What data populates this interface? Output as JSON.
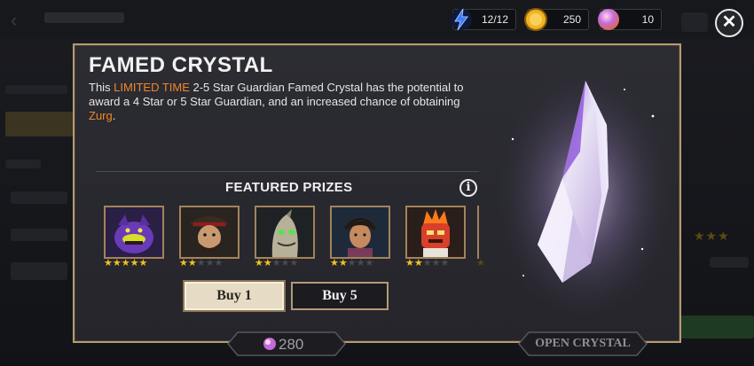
{
  "currencies": {
    "energy": {
      "value": "12/12",
      "icon": "energy-bolt-icon",
      "color": "#3b7bff"
    },
    "gold": {
      "value": "250",
      "icon": "gold-coin-icon",
      "color": "#f2b322"
    },
    "orbs": {
      "value": "10",
      "icon": "crystal-orb-icon",
      "color": "#c46bd8"
    }
  },
  "close_label": "✕",
  "panel": {
    "title": "FAMED CRYSTAL",
    "desc_part1": "This ",
    "desc_highlight1": "LIMITED TIME",
    "desc_part2": " 2-5 Star Guardian Famed Crystal has the potential to award a 4 Star or 5 Star Guardian, and an increased chance of obtaining ",
    "desc_highlight2": "Zurg",
    "desc_part3": ".",
    "accent_color": "#f0872a"
  },
  "featured": {
    "title": "FEATURED PRIZES",
    "info_label": "i",
    "prizes": [
      {
        "name": "Zurg",
        "stars": 5,
        "max_stars": 5
      },
      {
        "name": "Jack Sparrow",
        "stars": 2,
        "max_stars": 5
      },
      {
        "name": "Oogie Boogie",
        "stars": 2,
        "max_stars": 5
      },
      {
        "name": "Aladdin",
        "stars": 2,
        "max_stars": 5
      },
      {
        "name": "Anger",
        "stars": 2,
        "max_stars": 5
      }
    ]
  },
  "buttons": {
    "buy1": "Buy 1",
    "buy5": "Buy 5"
  },
  "footer": {
    "price": "280",
    "open_label": "OPEN CRYSTAL"
  }
}
